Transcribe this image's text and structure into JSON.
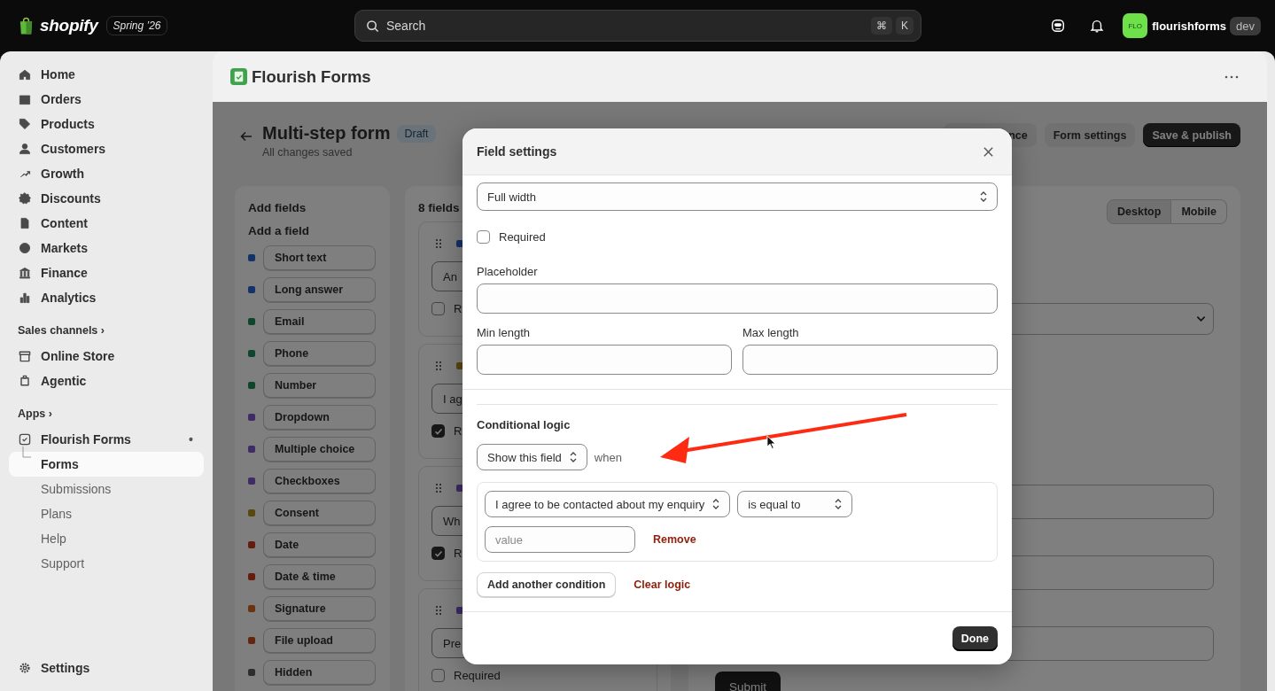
{
  "top_bar": {
    "brand": "shopify",
    "edition": "Spring ’26",
    "search_placeholder": "Search",
    "shortcut_keys": [
      "⌘",
      "K"
    ],
    "avatar_initials": "FLO",
    "store": "flourishforms",
    "store_badge": "dev"
  },
  "sidebar": {
    "items": [
      {
        "label": "Home",
        "selected": false
      },
      {
        "label": "Orders",
        "selected": false
      },
      {
        "label": "Products",
        "selected": false
      },
      {
        "label": "Customers",
        "selected": false
      },
      {
        "label": "Growth",
        "selected": false
      },
      {
        "label": "Discounts",
        "selected": false
      },
      {
        "label": "Content",
        "selected": false
      },
      {
        "label": "Markets",
        "selected": false
      },
      {
        "label": "Finance",
        "selected": false
      },
      {
        "label": "Analytics",
        "selected": false
      }
    ],
    "sales_channels": {
      "title": "Sales channels",
      "title_mark": "›",
      "items": [
        {
          "label": "Online Store",
          "selected": false
        },
        {
          "label": "Agentic",
          "selected": false
        }
      ]
    },
    "apps": {
      "title": "Apps",
      "title_mark": "›",
      "app": {
        "label": "Flourish Forms",
        "mark": "•",
        "children": [
          {
            "label": "Forms",
            "selected": true
          },
          {
            "label": "Submissions",
            "selected": false
          },
          {
            "label": "Plans",
            "selected": false
          },
          {
            "label": "Help",
            "selected": false
          },
          {
            "label": "Support",
            "selected": false
          }
        ]
      }
    },
    "settings": "Settings"
  },
  "app_header": {
    "title": "Flourish Forms"
  },
  "page": {
    "title": "Multi-step form",
    "status": "Draft",
    "subtitle": "All changes saved",
    "actions": [
      {
        "label": "nce",
        "kind": "secondary"
      },
      {
        "label": "Form settings",
        "kind": "secondary"
      },
      {
        "label": "Save & publish",
        "kind": "primary"
      }
    ]
  },
  "add_fields": {
    "title": "Add fields",
    "subtitle": "Add a field",
    "types": [
      {
        "label": "Short text",
        "color": "#13326a"
      },
      {
        "label": "Long answer",
        "color": "#13326a"
      },
      {
        "label": "Email",
        "color": "#0f452c"
      },
      {
        "label": "Phone",
        "color": "#0f452c"
      },
      {
        "label": "Number",
        "color": "#0f452c"
      },
      {
        "label": "Dropdown",
        "color": "#3f2b66"
      },
      {
        "label": "Multiple choice",
        "color": "#3f2b66"
      },
      {
        "label": "Checkboxes",
        "color": "#3f2b66"
      },
      {
        "label": "Consent",
        "color": "#5a460f"
      },
      {
        "label": "Date",
        "color": "#641c0f"
      },
      {
        "label": "Date & time",
        "color": "#641c0f"
      },
      {
        "label": "Signature",
        "color": "#6a330f"
      },
      {
        "label": "File upload",
        "color": "#64250f"
      },
      {
        "label": "Hidden",
        "color": "#2d2d2d"
      }
    ]
  },
  "fields": {
    "title": "8 fields",
    "items": [
      {
        "color": "#13326a",
        "value": "An",
        "required_label": "R",
        "required": false
      },
      {
        "color": "#5a460f",
        "value": "I ag",
        "required_label": "R",
        "required": true
      },
      {
        "color": "#3f2b66",
        "value": "Wh",
        "required_label": "R",
        "required": true
      },
      {
        "color": "#3f2b66",
        "value": "Pre",
        "required_label": "Required",
        "required": false
      }
    ]
  },
  "preview": {
    "view_toggle": [
      {
        "label": "Desktop",
        "selected": true
      },
      {
        "label": "Mobile",
        "selected": false
      }
    ],
    "submit": "Submit"
  },
  "modal": {
    "title": "Field settings",
    "width_select": "Full width",
    "required": {
      "label": "Required",
      "checked": false
    },
    "placeholder_label": "Placeholder",
    "length_labels": [
      "Min length",
      "Max length"
    ],
    "conditional_logic": {
      "title": "Conditional logic",
      "action": "Show this field",
      "connector": "when",
      "conditions": [
        {
          "field": "I agree to be contacted about my enquiry",
          "operator": "is equal to",
          "value_placeholder": "value",
          "remove": "Remove"
        }
      ],
      "add_button": "Add another condition",
      "clear_link": "Clear logic"
    },
    "done_button": "Done"
  }
}
